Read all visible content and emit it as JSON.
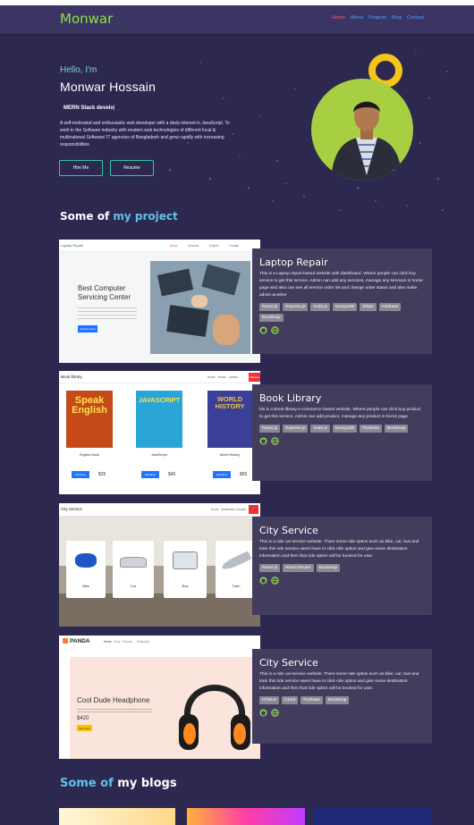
{
  "nav": {
    "logo": "Monwar",
    "links": [
      "Home",
      "About",
      "Projects",
      "Blog",
      "Contact"
    ]
  },
  "hero": {
    "greeting": "Hello, I'm",
    "name": "Monwar Hossain",
    "typed_text": "MERN Stack develo",
    "description": "A self-motivated and enthusiastic web developer with a deep interest in JavaScript. To work in the Software industry with modern web technologies of different local & multinational Software/ IT agencies of Bangladesh and grow rapidly with increasing responsibilities",
    "hire_label": "Hire Me",
    "resume_label": "Resume"
  },
  "projects_heading": {
    "part1": "Some of ",
    "part2": "my project"
  },
  "projects": [
    {
      "title": "Laptop Repair",
      "description": "This is a Laptop repair-based website with dashboard. Where people can click buy service to get this service. Admin can add any services, manage any services in home page and also can see all service order list and change order status and also make admin another",
      "tags": [
        "React.js",
        "Express.js",
        "node.js",
        "MongoDB",
        "Stripe",
        "Firebase",
        "Bootstrap"
      ],
      "preview": {
        "brand": "Laptop Repair",
        "nav": [
          "Home",
          "Services",
          "Explore",
          "Contact"
        ],
        "headline": "Best Computer Servicing Center",
        "cta": "Explore Now"
      }
    },
    {
      "title": "Book Library",
      "description": "his is a Book-library e-commerce based website. Where people can click buy product to get this service. Admin can add product, manage any product in home page.",
      "tags": [
        "React.js",
        "Express.js",
        "node.js",
        "MongoDB",
        "Firebase",
        "Bootstrap"
      ],
      "preview": {
        "brand": "Book library",
        "nav": [
          "Home",
          "Books",
          "Orders",
          "Manage"
        ],
        "books": [
          {
            "cover": "Speak English",
            "name": "English Book",
            "price": "$25"
          },
          {
            "cover": "JAVASCRIPT",
            "name": "JavaScript",
            "price": "$40"
          },
          {
            "cover": "WORLD HISTORY",
            "name": "World History",
            "price": "$65"
          }
        ],
        "buy": "Add Book"
      }
    },
    {
      "title": "City Service",
      "description": "This is a ride car-service website. There some ride option such as bike, car, bus and train this ride service users have to click ride option and give some destination information and then that ride option will be booked for user.",
      "tags": [
        "React.js",
        "React Router",
        "Bootstrap"
      ],
      "preview": {
        "brand": "City Service",
        "nav": [
          "Home",
          "Destination",
          "Contact"
        ],
        "rides": [
          "Bike",
          "Car",
          "Bus",
          "Train"
        ]
      }
    },
    {
      "title": "City Service",
      "description": "This is a ride car-service website. There some ride option such as bike, car, bus and train this ride service users have to click ride option and give some destination information and then that ride option will be booked for user.",
      "tags": [
        "HTML5",
        "CSS3",
        "Firebase",
        "Bootstrap"
      ],
      "preview": {
        "brand": "PANDA",
        "nav": [
          "Home",
          "Shop",
          "Product",
          "Subscribe"
        ],
        "headline": "Cool Dude Headphone",
        "price": "$420",
        "cta": "Buy Now"
      }
    }
  ],
  "blogs_heading": {
    "part1": "Some of ",
    "part2": "my blogs"
  },
  "colors": {
    "background": "#2d2850",
    "card": "#423d5c",
    "accent_green": "#8fe04a",
    "accent_teal": "#2ec8a2"
  }
}
